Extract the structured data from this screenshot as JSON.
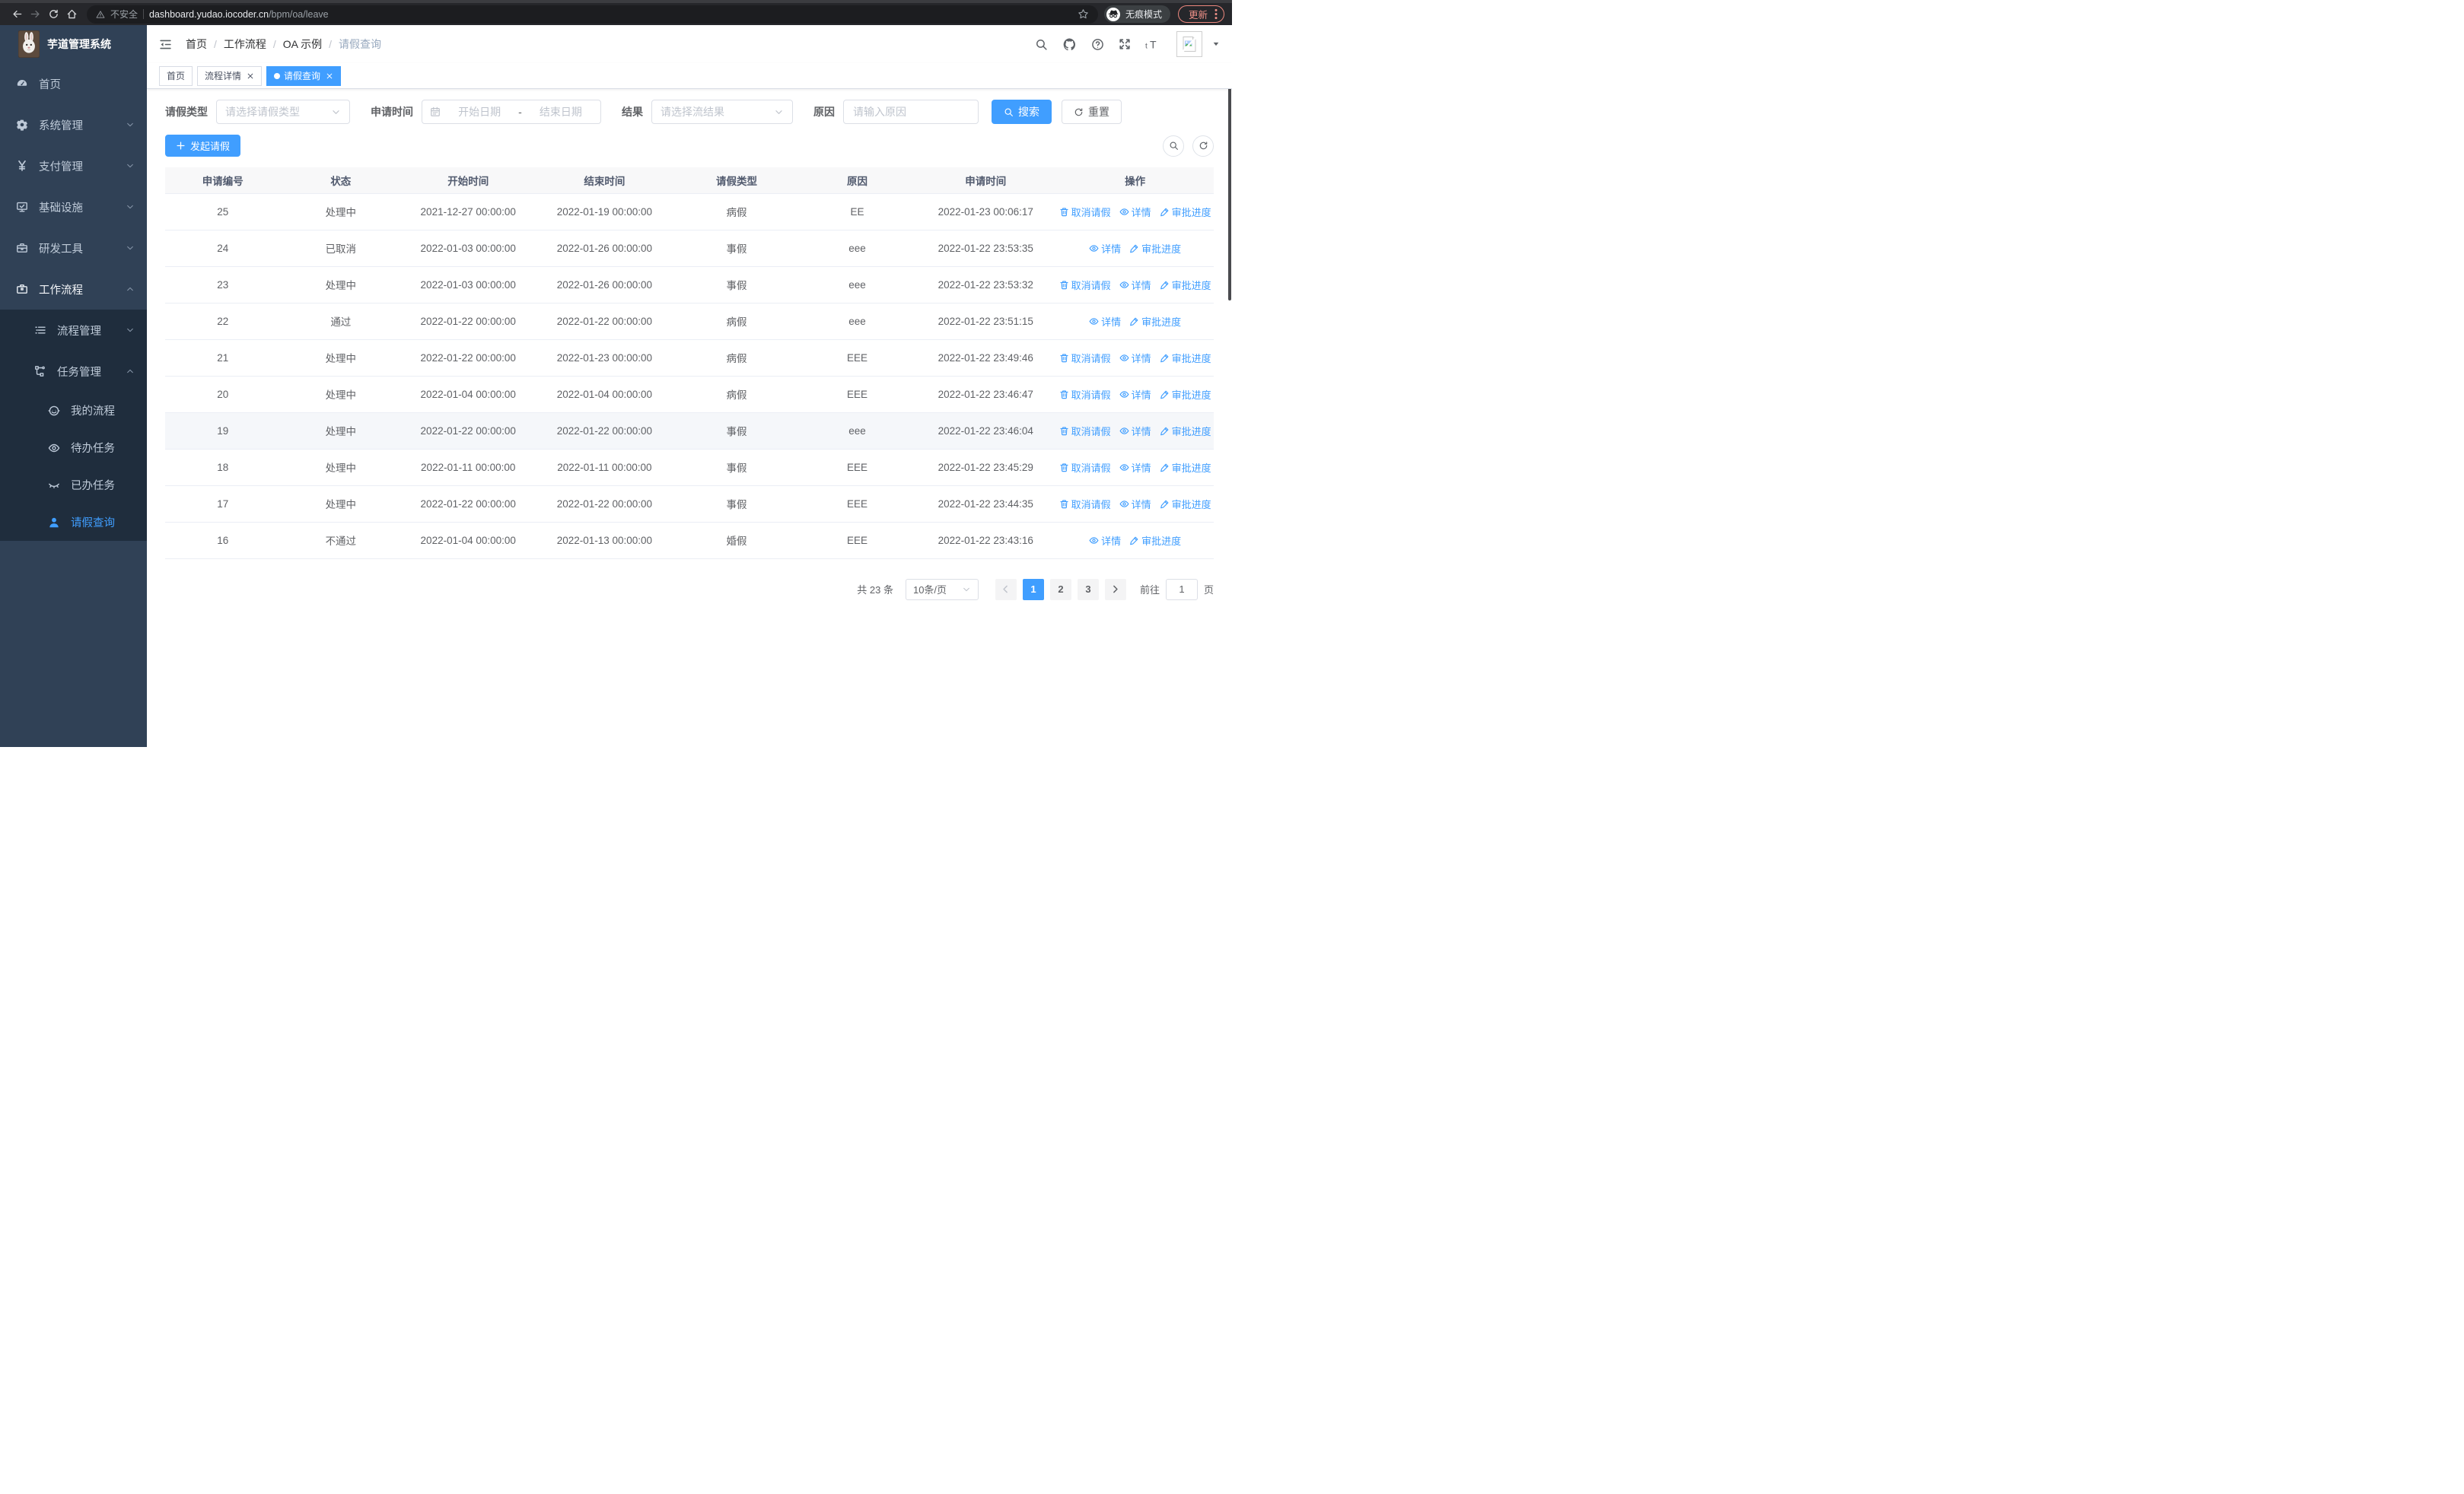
{
  "browser": {
    "security_warning": "不安全",
    "url_domain": "dashboard.yudao.iocoder.cn",
    "url_path": "/bpm/oa/leave",
    "incognito_label": "无痕模式",
    "update_button": "更新"
  },
  "app": {
    "title": "芋道管理系统"
  },
  "colors": {
    "accent": "#409eff",
    "sidebar_bg": "#304156",
    "submenu_bg": "#1f2d3d",
    "update_button": "#ee9087"
  },
  "sidebar": {
    "items": [
      {
        "label": "首页",
        "icon": "dashboard-icon"
      },
      {
        "label": "系统管理",
        "icon": "gear-icon",
        "chevron": "down"
      },
      {
        "label": "支付管理",
        "icon": "yen-icon",
        "chevron": "down"
      },
      {
        "label": "基础设施",
        "icon": "monitor-icon",
        "chevron": "down"
      },
      {
        "label": "研发工具",
        "icon": "toolbox-icon",
        "chevron": "down"
      },
      {
        "label": "工作流程",
        "icon": "briefcase-icon",
        "chevron": "up",
        "open": true,
        "children": [
          {
            "label": "流程管理",
            "icon": "list-icon",
            "chevron": "down"
          },
          {
            "label": "任务管理",
            "icon": "flow-icon",
            "chevron": "up",
            "children": [
              {
                "label": "我的流程",
                "icon": "robot-icon"
              },
              {
                "label": "待办任务",
                "icon": "eye-open-icon"
              },
              {
                "label": "已办任务",
                "icon": "eye-closed-icon"
              },
              {
                "label": "请假查询",
                "icon": "user-icon",
                "active": true
              }
            ]
          }
        ]
      }
    ]
  },
  "breadcrumb": [
    "首页",
    "工作流程",
    "OA 示例",
    "请假查询"
  ],
  "tabs": [
    {
      "label": "首页",
      "closable": false,
      "active": false
    },
    {
      "label": "流程详情",
      "closable": true,
      "active": false
    },
    {
      "label": "请假查询",
      "closable": true,
      "active": true
    }
  ],
  "filters": {
    "leave_type_label": "请假类型",
    "leave_type_placeholder": "请选择请假类型",
    "apply_time_label": "申请时间",
    "start_date_placeholder": "开始日期",
    "date_separator": "-",
    "end_date_placeholder": "结束日期",
    "result_label": "结果",
    "result_placeholder": "请选择流结果",
    "reason_label": "原因",
    "reason_placeholder": "请输入原因",
    "search_button": "搜索",
    "reset_button": "重置"
  },
  "toolbar": {
    "create_button": "发起请假"
  },
  "table": {
    "columns": [
      "申请编号",
      "状态",
      "开始时间",
      "结束时间",
      "请假类型",
      "原因",
      "申请时间",
      "操作"
    ],
    "action_labels": {
      "cancel": "取消请假",
      "detail": "详情",
      "progress": "审批进度"
    },
    "rows": [
      {
        "id": "25",
        "status": "处理中",
        "start": "2021-12-27 00:00:00",
        "end": "2022-01-19 00:00:00",
        "type": "病假",
        "reason": "EE",
        "applied": "2022-01-23 00:06:17",
        "cancelable": true,
        "highlighted": false
      },
      {
        "id": "24",
        "status": "已取消",
        "start": "2022-01-03 00:00:00",
        "end": "2022-01-26 00:00:00",
        "type": "事假",
        "reason": "eee",
        "applied": "2022-01-22 23:53:35",
        "cancelable": false,
        "highlighted": false
      },
      {
        "id": "23",
        "status": "处理中",
        "start": "2022-01-03 00:00:00",
        "end": "2022-01-26 00:00:00",
        "type": "事假",
        "reason": "eee",
        "applied": "2022-01-22 23:53:32",
        "cancelable": true,
        "highlighted": false
      },
      {
        "id": "22",
        "status": "通过",
        "start": "2022-01-22 00:00:00",
        "end": "2022-01-22 00:00:00",
        "type": "病假",
        "reason": "eee",
        "applied": "2022-01-22 23:51:15",
        "cancelable": false,
        "highlighted": false
      },
      {
        "id": "21",
        "status": "处理中",
        "start": "2022-01-22 00:00:00",
        "end": "2022-01-23 00:00:00",
        "type": "病假",
        "reason": "EEE",
        "applied": "2022-01-22 23:49:46",
        "cancelable": true,
        "highlighted": false
      },
      {
        "id": "20",
        "status": "处理中",
        "start": "2022-01-04 00:00:00",
        "end": "2022-01-04 00:00:00",
        "type": "病假",
        "reason": "EEE",
        "applied": "2022-01-22 23:46:47",
        "cancelable": true,
        "highlighted": false
      },
      {
        "id": "19",
        "status": "处理中",
        "start": "2022-01-22 00:00:00",
        "end": "2022-01-22 00:00:00",
        "type": "事假",
        "reason": "eee",
        "applied": "2022-01-22 23:46:04",
        "cancelable": true,
        "highlighted": true
      },
      {
        "id": "18",
        "status": "处理中",
        "start": "2022-01-11 00:00:00",
        "end": "2022-01-11 00:00:00",
        "type": "事假",
        "reason": "EEE",
        "applied": "2022-01-22 23:45:29",
        "cancelable": true,
        "highlighted": false
      },
      {
        "id": "17",
        "status": "处理中",
        "start": "2022-01-22 00:00:00",
        "end": "2022-01-22 00:00:00",
        "type": "事假",
        "reason": "EEE",
        "applied": "2022-01-22 23:44:35",
        "cancelable": true,
        "highlighted": false
      },
      {
        "id": "16",
        "status": "不通过",
        "start": "2022-01-04 00:00:00",
        "end": "2022-01-13 00:00:00",
        "type": "婚假",
        "reason": "EEE",
        "applied": "2022-01-22 23:43:16",
        "cancelable": false,
        "highlighted": false
      }
    ]
  },
  "pagination": {
    "total_text": "共 23 条",
    "page_size": "10条/页",
    "pages": [
      "1",
      "2",
      "3"
    ],
    "active_page": "1",
    "goto_label": "前往",
    "goto_value": "1",
    "goto_suffix": "页"
  }
}
